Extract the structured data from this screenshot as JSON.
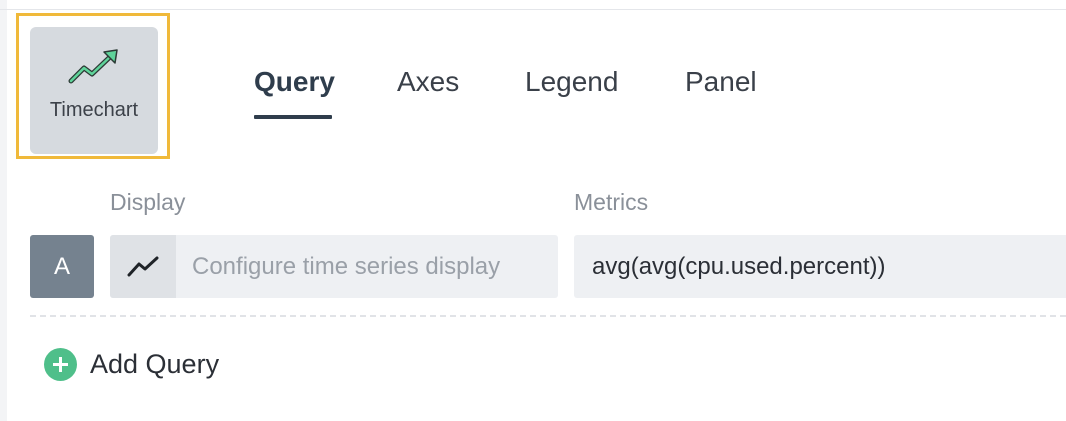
{
  "visualization": {
    "label": "Timechart",
    "icon": "trending-up-icon",
    "highlight_color": "#f0b93a"
  },
  "tabs": [
    {
      "label": "Query",
      "active": true
    },
    {
      "label": "Axes",
      "active": false
    },
    {
      "label": "Legend",
      "active": false
    },
    {
      "label": "Panel",
      "active": false
    }
  ],
  "columns": {
    "display_label": "Display",
    "metrics_label": "Metrics"
  },
  "query": {
    "letter": "A",
    "display_icon": "line-chart-icon",
    "display_placeholder": "Configure time series display",
    "metric": "avg(avg(cpu.used.percent))"
  },
  "add_query": {
    "label": "Add Query",
    "icon": "plus-circle-icon",
    "color": "#4fbf8a"
  }
}
